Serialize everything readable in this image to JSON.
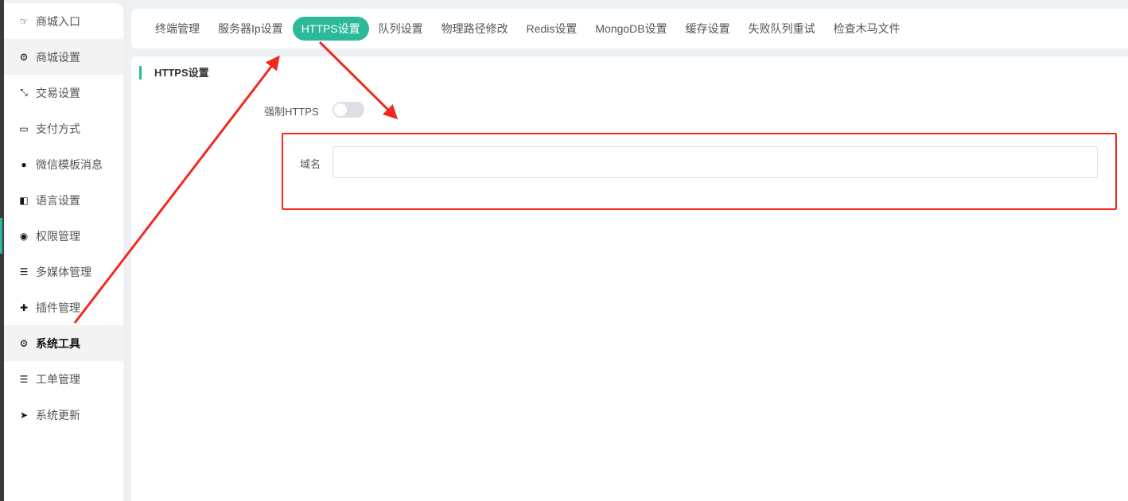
{
  "sidebar": {
    "items": [
      {
        "label": "商城入口",
        "icon": "hand-point-right-icon",
        "glyph": "☞"
      },
      {
        "label": "商城设置",
        "icon": "gear-icon",
        "glyph": "⚙"
      },
      {
        "label": "交易设置",
        "icon": "compress-arrows-icon",
        "glyph": "⤡"
      },
      {
        "label": "支付方式",
        "icon": "credit-card-icon",
        "glyph": "▭"
      },
      {
        "label": "微信模板消息",
        "icon": "wechat-icon",
        "glyph": "●"
      },
      {
        "label": "语言设置",
        "icon": "language-icon",
        "glyph": "◧"
      },
      {
        "label": "权限管理",
        "icon": "gamepad-icon",
        "glyph": "◉"
      },
      {
        "label": "多媒体管理",
        "icon": "list-icon",
        "glyph": "☰"
      },
      {
        "label": "插件管理",
        "icon": "puzzle-icon",
        "glyph": "✚"
      },
      {
        "label": "系统工具",
        "icon": "gear-icon",
        "glyph": "⚙"
      },
      {
        "label": "工单管理",
        "icon": "list-icon",
        "glyph": "☰"
      },
      {
        "label": "系统更新",
        "icon": "paper-plane-icon",
        "glyph": "➤"
      }
    ]
  },
  "tabs": [
    "终端管理",
    "服务器Ip设置",
    "HTTPS设置",
    "队列设置",
    "物理路径修改",
    "Redis设置",
    "MongoDB设置",
    "缓存设置",
    "失败队列重试",
    "检查木马文件"
  ],
  "main": {
    "section_title": "HTTPS设置",
    "force_https_label": "强制HTTPS",
    "force_https": false,
    "domain_label": "域名",
    "domain_value": ""
  },
  "colors": {
    "accent": "#2bb99a",
    "annotation": "#f02a20"
  }
}
